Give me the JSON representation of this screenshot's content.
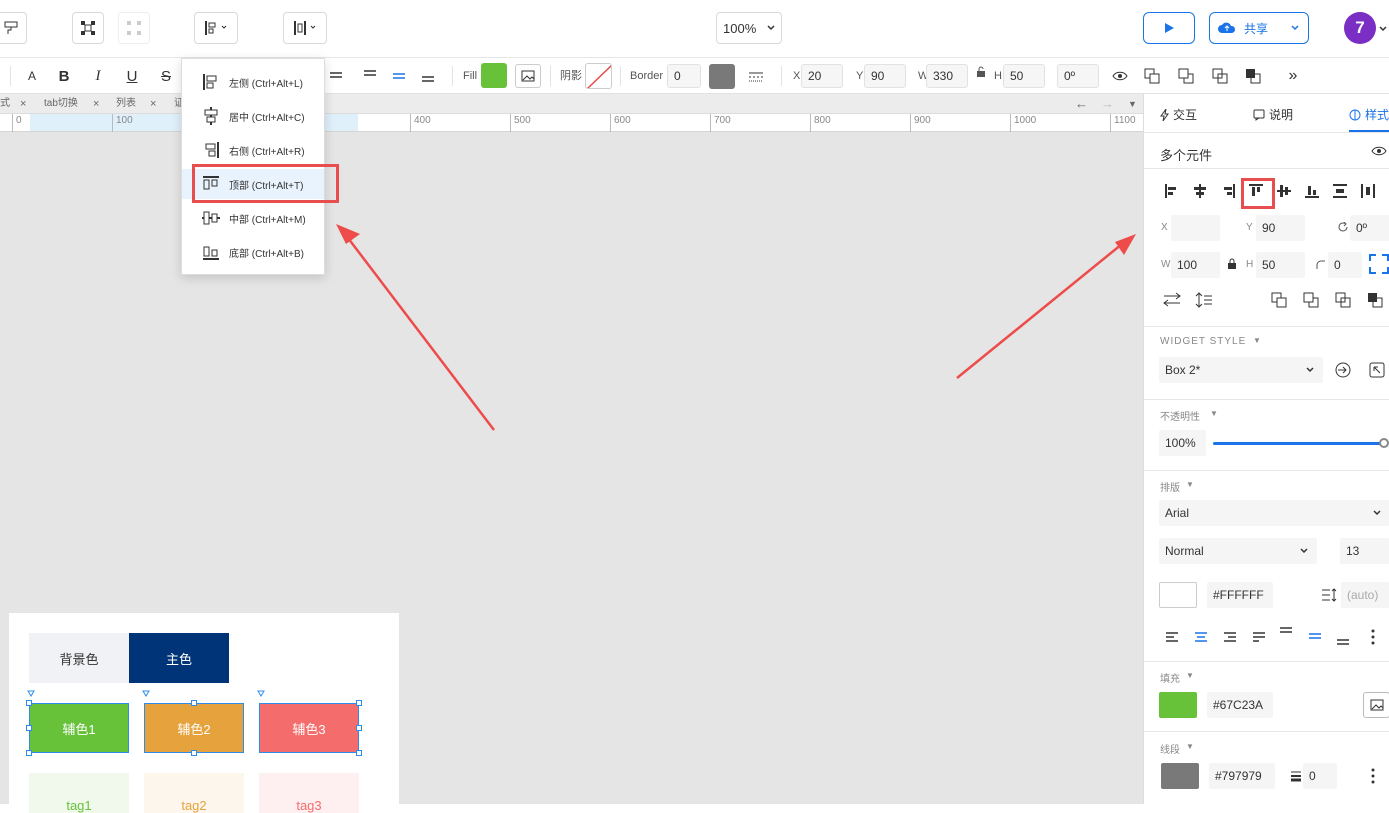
{
  "topbar": {
    "zoom": "100%",
    "share_label": "共享",
    "avatar_label": "7"
  },
  "toolbar": {
    "fill_label": "Fill",
    "shadow_label": "阴影",
    "border_label": "Border",
    "border_value": "0",
    "x_label": "X",
    "x_value": "20",
    "y_label": "Y",
    "y_value": "90",
    "w_label": "W",
    "w_value": "330",
    "h_label": "H",
    "h_value": "50",
    "rotation_value": "0º",
    "more_label": "»"
  },
  "colors": {
    "fill": "#67C23A",
    "border": "#797979",
    "accent": "#1a73e8",
    "highlight": "#e84e4e"
  },
  "tabs": [
    {
      "label": "式"
    },
    {
      "label": "tab切换"
    },
    {
      "label": "列表"
    },
    {
      "label": "证"
    }
  ],
  "ruler": [
    "0",
    "100",
    "400",
    "500",
    "600",
    "700",
    "800",
    "900",
    "1000",
    "1100"
  ],
  "align_menu": {
    "items": [
      {
        "label": "左侧 (Ctrl+Alt+L)",
        "icon": "align-left-icon"
      },
      {
        "label": "居中 (Ctrl+Alt+C)",
        "icon": "align-center-icon"
      },
      {
        "label": "右侧 (Ctrl+Alt+R)",
        "icon": "align-right-icon"
      },
      {
        "label": "顶部 (Ctrl+Alt+T)",
        "icon": "align-top-icon"
      },
      {
        "label": "中部 (Ctrl+Alt+M)",
        "icon": "align-middle-icon"
      },
      {
        "label": "底部 (Ctrl+Alt+B)",
        "icon": "align-bottom-icon"
      }
    ]
  },
  "panel": {
    "tabs": [
      "交互",
      "说明",
      "样式"
    ],
    "title": "多个元件",
    "x_label": "X",
    "x_value": "",
    "y_label": "Y",
    "y_value": "90",
    "rotation": "0º",
    "w_label": "W",
    "w_value": "100",
    "h_label": "H",
    "h_value": "50",
    "radius": "0",
    "widget_style_title": "WIDGET STYLE",
    "widget_style_value": "Box 2*",
    "opacity_title": "不透明性",
    "opacity_value": "100%",
    "typography_title": "排版",
    "font_family": "Arial",
    "font_weight": "Normal",
    "font_size": "13",
    "text_color": "#FFFFFF",
    "line_height": "(auto)",
    "fill_title": "填充",
    "fill_hex": "#67C23A",
    "stroke_title": "线段",
    "stroke_hex": "#797979",
    "stroke_width": "0"
  },
  "canvas": {
    "bg_label": "背景色",
    "main_label": "主色",
    "aux1": "辅色1",
    "aux2": "辅色2",
    "aux3": "辅色3",
    "tag1": "tag1",
    "tag2": "tag2",
    "tag3": "tag3"
  }
}
